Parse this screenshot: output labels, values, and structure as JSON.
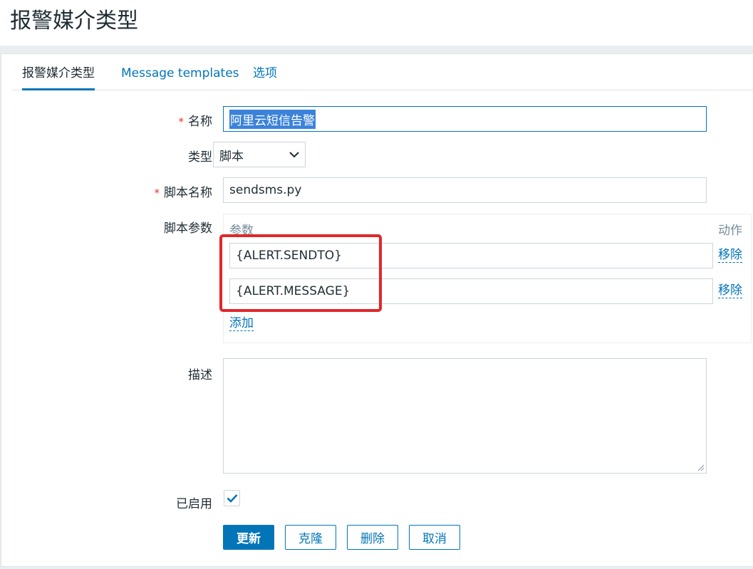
{
  "page": {
    "title": "报警媒介类型"
  },
  "tabs": [
    {
      "label": "报警媒介类型"
    },
    {
      "label": "Message templates"
    },
    {
      "label": "选项"
    }
  ],
  "form": {
    "name": {
      "label": "名称",
      "required_mark": "*",
      "value": "阿里云短信告警"
    },
    "type": {
      "label": "类型",
      "value": "脚本"
    },
    "script_name": {
      "label": "脚本名称",
      "required_mark": "*",
      "value": "sendsms.py"
    },
    "script_params": {
      "label": "脚本参数",
      "col_param": "参数",
      "col_action": "动作",
      "rows": [
        {
          "value": "{ALERT.SENDTO}",
          "action": "移除"
        },
        {
          "value": "{ALERT.MESSAGE}",
          "action": "移除"
        }
      ],
      "add_label": "添加"
    },
    "description": {
      "label": "描述",
      "value": ""
    },
    "enabled": {
      "label": "已启用",
      "checked": true
    }
  },
  "buttons": {
    "update": "更新",
    "clone": "克隆",
    "delete": "删除",
    "cancel": "取消"
  },
  "colors": {
    "accent": "#0275b8",
    "required": "#e33734",
    "highlight": "#e0272a"
  }
}
